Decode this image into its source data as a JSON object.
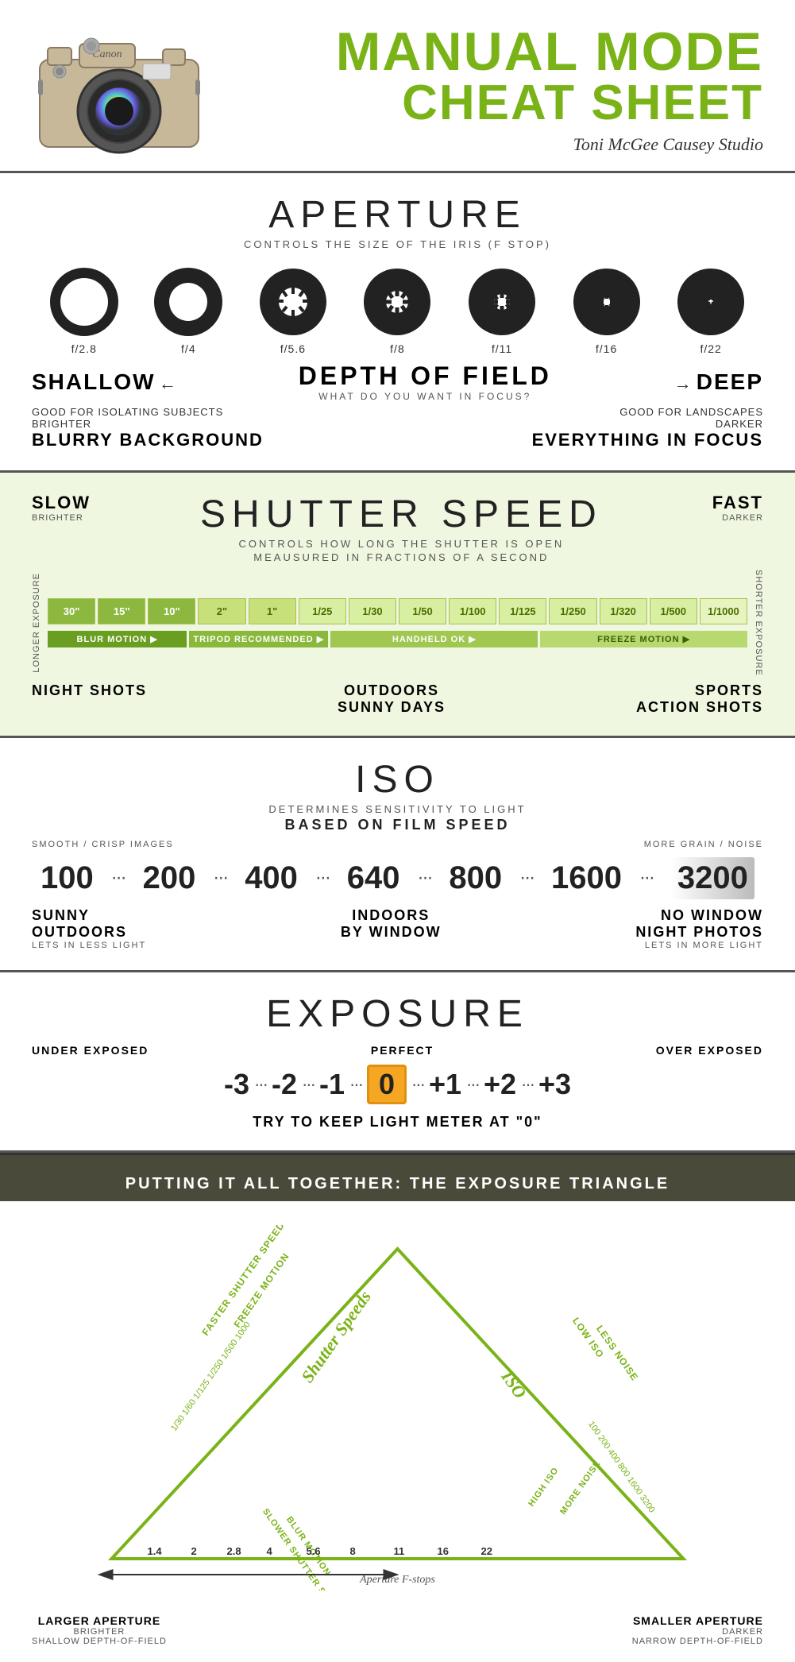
{
  "header": {
    "title_line1": "MANUAL MODE",
    "title_line2": "CHEAT SHEET",
    "author": "Toni McGee Causey Studio",
    "camera_brand": "Canon"
  },
  "aperture": {
    "section_title": "APERTURE",
    "section_subtitle": "CONTROLS THE SIZE OF THE IRIS (F STOP)",
    "f_stops": [
      "f/2.8",
      "f/4",
      "f/5.6",
      "f/8",
      "f/11",
      "f/16",
      "f/22"
    ],
    "dof_title": "DEPTH OF FIELD",
    "dof_subtitle": "WHAT DO YOU WANT IN FOCUS?",
    "shallow_label": "SHALLOW",
    "deep_label": "DEEP",
    "left_note1": "GOOD FOR ISOLATING SUBJECTS",
    "left_note2": "BRIGHTER",
    "left_bold": "BLURRY BACKGROUND",
    "right_note1": "GOOD FOR LANDSCAPES",
    "right_note2": "DARKER",
    "right_bold": "EVERYTHING IN FOCUS"
  },
  "shutter": {
    "section_title": "SHUTTER SPEED",
    "section_subtitle": "CONTROLS HOW LONG THE SHUTTER IS OPEN",
    "section_subtitle2": "MEAUSURED IN FRACTIONS OF A SECOND",
    "slow_label": "SLOW",
    "slow_sub": "BRIGHTER",
    "fast_label": "FAST",
    "fast_sub": "DARKER",
    "speeds": [
      "30\"",
      "15\"",
      "10\"",
      "2\"",
      "1\"",
      "1/25",
      "1/30",
      "1/50",
      "1/100",
      "1/125",
      "1/250",
      "1/320",
      "1/500",
      "1/1000"
    ],
    "longer_exposure": "LONGER EXPOSURE",
    "shorter_exposure": "SHORTER EXPOSURE",
    "motion_labels": [
      "BLUR MOTION",
      "TRIPOD RECOMMENDED",
      "HANDHELD OK",
      "FREEZE MOTION"
    ],
    "use_labels": [
      "NIGHT SHOTS",
      "OUTDOORS\nSUNNY DAYS",
      "SPORTS\nACTION SHOTS"
    ]
  },
  "iso": {
    "section_title": "ISO",
    "section_subtitle": "DETERMINES SENSITIVITY TO LIGHT",
    "section_subtitle2": "BASED ON FILM SPEED",
    "smooth_label": "SMOOTH / CRISP IMAGES",
    "grain_label": "MORE GRAIN / NOISE",
    "values": [
      "100",
      "200",
      "400",
      "640",
      "800",
      "1600",
      "3200"
    ],
    "use_labels": [
      {
        "main": "SUNNY\nOUTDOORS",
        "sub": "LETS IN LESS LIGHT"
      },
      {
        "main": "INDOORS\nBY WINDOW",
        "sub": ""
      },
      {
        "main": "NO WINDOW\nNIGHT PHOTOS",
        "sub": "LETS IN MORE LIGHT"
      }
    ]
  },
  "exposure": {
    "section_title": "EXPOSURE",
    "under_label": "UNDER EXPOSED",
    "perfect_label": "PERFECT",
    "over_label": "OVER EXPOSED",
    "scale": [
      "-3",
      "-2",
      "-1",
      "0",
      "+1",
      "+2",
      "+3"
    ],
    "tip": "TRY TO KEEP LIGHT METER AT \"0\""
  },
  "triangle": {
    "header": "PUTTING IT ALL TOGETHER: THE EXPOSURE TRIANGLE",
    "left_label": "LARGER APERTURE",
    "left_sub1": "BRIGHTER",
    "left_sub2": "SHALLOW DEPTH-OF-FIELD",
    "right_label": "SMALLER APERTURE",
    "right_sub1": "DARKER",
    "right_sub2": "NARROW DEPTH-OF-FIELD",
    "aperture_label": "Aperture F-stops",
    "fstops": "1.4  2  2.8  4  5.6  8  11  16  22",
    "shutter_label": "Shutter Speeds",
    "iso_label": "ISO",
    "left_side_label1": "FASTER SHUTTER SPEED",
    "left_side_label2": "FREEZE MOTION",
    "right_side_label1": "LOW ISO",
    "right_side_label2": "LESS NOISE",
    "left_low_label": "SLOWER SHUTTER SPEED",
    "left_low_label2": "BLUR MOTION",
    "right_low_label": "HIGH ISO",
    "right_low_label2": "MORE NOISE"
  },
  "colors": {
    "green_accent": "#7ab317",
    "light_green_bg": "#f0f7e0",
    "speed_bar_dark": "#8db840",
    "speed_bar_light": "#c8e07a",
    "orange_zero": "#f5a623",
    "triangle_dark_bg": "#4a4a3a"
  }
}
